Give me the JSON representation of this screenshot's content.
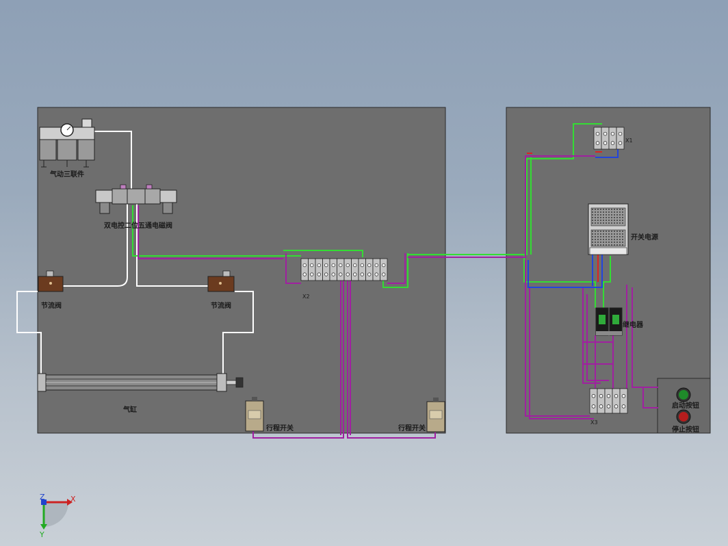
{
  "labels": {
    "frl_unit": "气动三联件",
    "solenoid_valve": "双电控二位五通电磁阀",
    "throttle_valve_left": "节流阀",
    "throttle_valve_right": "节流阀",
    "cylinder": "气缸",
    "limit_switch_left": "行程开关",
    "limit_switch_right": "行程开关",
    "terminal_x2": "X2",
    "terminal_x1": "X1",
    "terminal_x3": "X3",
    "power_supply": "开关电源",
    "relay": "继电器",
    "start_button": "启动按钮",
    "stop_button": "停止按钮"
  },
  "axes": {
    "x": "X",
    "y": "Y",
    "z": "Z"
  },
  "colors": {
    "background_top": "#8ea0b6",
    "panel": "#6e6e6e",
    "air_line": "#ffffff",
    "wire_green": "#33dd33",
    "wire_purple": "#a020a0",
    "wire_blue": "#2244dd",
    "wire_red": "#dd2222",
    "start_button": "#1f8a2a",
    "stop_button": "#b51d1d"
  }
}
